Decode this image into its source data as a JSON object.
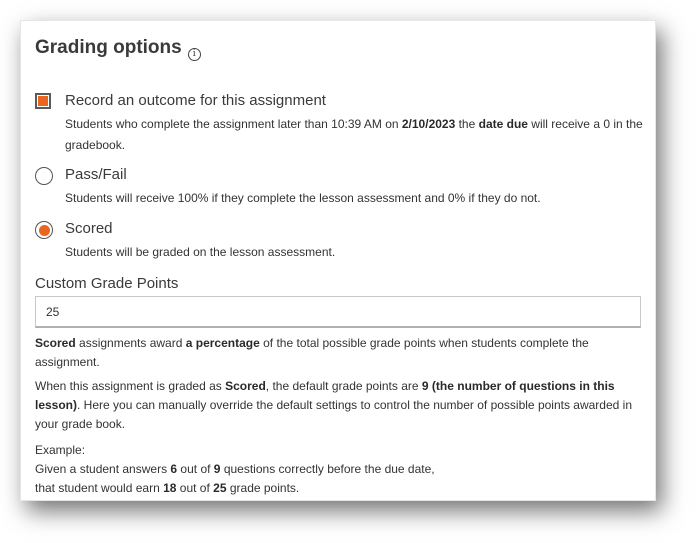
{
  "title": "Grading options",
  "info_icon": "info-icon",
  "options": [
    {
      "type": "checkbox",
      "checked": true,
      "label": "Record an outcome for this assignment",
      "desc_parts": [
        "Students who complete the assignment later than 10:39 AM on ",
        "2/10/2023",
        " the ",
        "date due",
        " will receive a 0 in the gradebook."
      ]
    },
    {
      "type": "radio",
      "checked": false,
      "label": "Pass/Fail",
      "desc": "Students will receive 100% if they complete the lesson assessment and 0% if they do not."
    },
    {
      "type": "radio",
      "checked": true,
      "label": "Scored",
      "desc": "Students will be graded on the lesson assessment."
    }
  ],
  "custom_points": {
    "label": "Custom Grade Points",
    "value": "25"
  },
  "para1": [
    "Scored",
    " assignments award ",
    "a percentage",
    " of the total possible grade points when students complete the assignment."
  ],
  "para2": [
    "When this assignment is graded as ",
    "Scored",
    ", the default grade points are ",
    "9 (the number of questions in this lesson)",
    ". Here you can manually override the default settings to control the number of possible points awarded in your grade book."
  ],
  "example": {
    "heading": "Example:",
    "line1": [
      "Given a student answers ",
      "6",
      " out of ",
      "9",
      " questions correctly before the due date,"
    ],
    "line2": [
      "that student would earn ",
      "18",
      " out of ",
      "25",
      " grade points."
    ]
  },
  "colors": {
    "accent": "#e9661c"
  }
}
